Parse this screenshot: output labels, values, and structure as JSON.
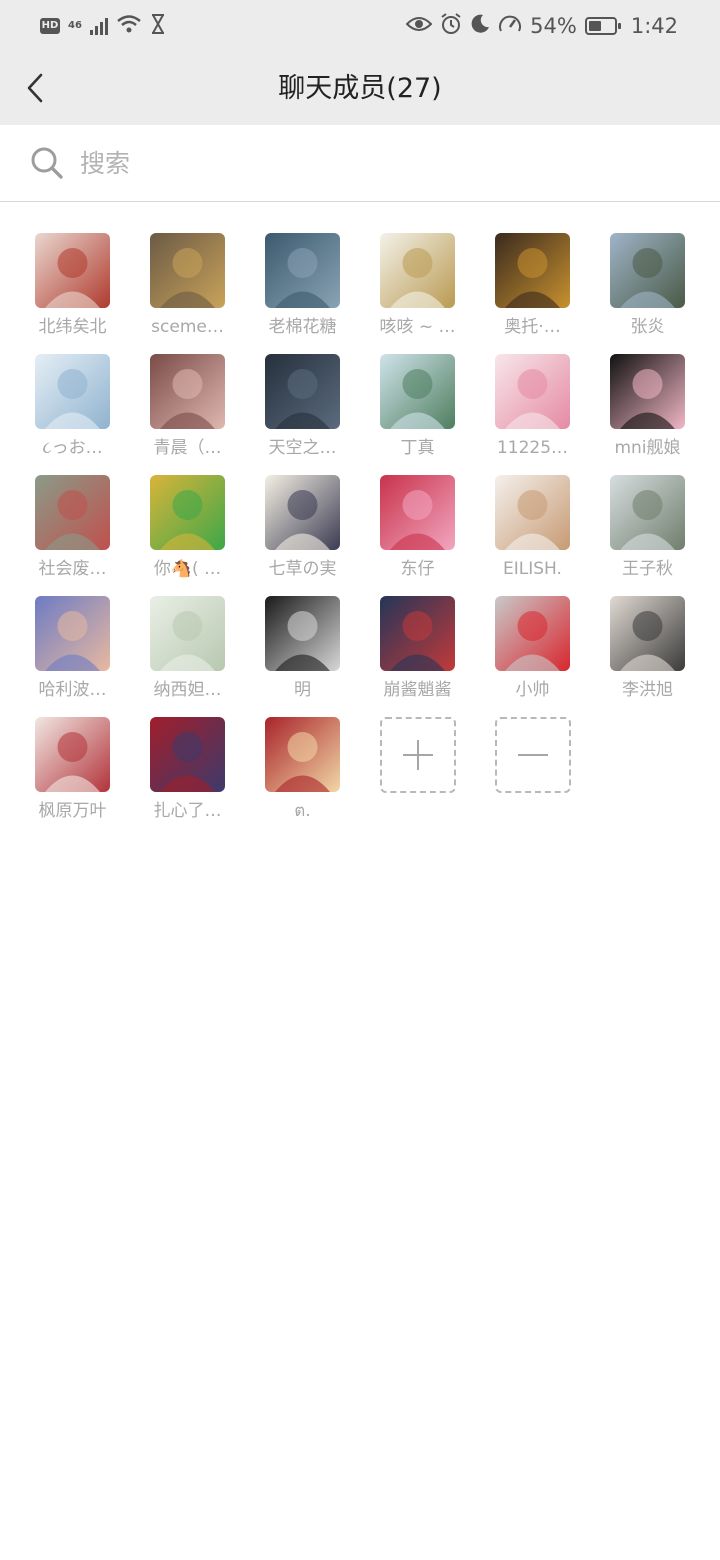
{
  "status_bar": {
    "hd_label": "HD",
    "network_label": "46",
    "battery_text": "54%",
    "battery_level_percent": 54,
    "time": "1:42",
    "icons": [
      "hd-icon",
      "signal-icon",
      "wifi-icon",
      "hourglass-icon",
      "eye-icon",
      "alarm-icon",
      "moon-icon",
      "speedometer-icon",
      "battery-icon"
    ]
  },
  "header": {
    "title": "聊天成员(27)",
    "back_icon": "chevron-left-icon",
    "background": "#ececec"
  },
  "search": {
    "placeholder": "搜索",
    "value": "",
    "icon": "search-icon"
  },
  "members": [
    {
      "name": "北纬矣北",
      "colors": [
        "#e9d7cf",
        "#b03a2e"
      ]
    },
    {
      "name": "sceme…",
      "colors": [
        "#6b5a45",
        "#c9a35a"
      ]
    },
    {
      "name": "老棉花糖",
      "colors": [
        "#3c5a6e",
        "#8aa3b5"
      ]
    },
    {
      "name": "咳咳 ~ …",
      "colors": [
        "#f3f1e8",
        "#b99a52"
      ]
    },
    {
      "name": "奥托·…",
      "colors": [
        "#3a2a1e",
        "#c8912f"
      ]
    },
    {
      "name": "张炎",
      "colors": [
        "#9fb4c8",
        "#4a5a46"
      ]
    },
    {
      "name": "૮っお…",
      "colors": [
        "#e5eef5",
        "#8fb3cf"
      ]
    },
    {
      "name": "青晨（…",
      "colors": [
        "#7a4b48",
        "#e0b8b0"
      ]
    },
    {
      "name": "天空之…",
      "colors": [
        "#26303c",
        "#5b6b7e"
      ]
    },
    {
      "name": "丁真",
      "colors": [
        "#cfe3ea",
        "#4f7e5f"
      ]
    },
    {
      "name": "11225…",
      "colors": [
        "#f7e6ea",
        "#e58aa4"
      ]
    },
    {
      "name": "mni舰娘",
      "colors": [
        "#111111",
        "#f2b7c6"
      ]
    },
    {
      "name": "社会废…",
      "colors": [
        "#8a9b88",
        "#c0504d"
      ]
    },
    {
      "name": "你🐴( …",
      "colors": [
        "#d9b43b",
        "#3da748"
      ]
    },
    {
      "name": "七草の実",
      "colors": [
        "#f4efe3",
        "#3b3b52"
      ]
    },
    {
      "name": "东仔",
      "colors": [
        "#c9324b",
        "#f2a6c0"
      ]
    },
    {
      "name": "EILISH.",
      "colors": [
        "#f4f0ec",
        "#c79a73"
      ]
    },
    {
      "name": "王子秋",
      "colors": [
        "#d7dde0",
        "#6f7e6c"
      ]
    },
    {
      "name": "哈利波…",
      "colors": [
        "#6d7bc4",
        "#e8b9a0"
      ]
    },
    {
      "name": "纳西妲…",
      "colors": [
        "#e9efe6",
        "#b8c8b0"
      ]
    },
    {
      "name": "明",
      "colors": [
        "#1a1a1a",
        "#d8d8d8"
      ]
    },
    {
      "name": "崩酱魈酱",
      "colors": [
        "#243559",
        "#c23a3a"
      ]
    },
    {
      "name": "小帅",
      "colors": [
        "#c9c9c9",
        "#d8262e"
      ]
    },
    {
      "name": "李洪旭",
      "colors": [
        "#e1dad3",
        "#3a3a3a"
      ]
    },
    {
      "name": "枫原万叶",
      "colors": [
        "#f1e7e2",
        "#b2333a"
      ]
    },
    {
      "name": "扎心了…",
      "colors": [
        "#a11e2a",
        "#3d3a6b"
      ]
    },
    {
      "name": "ต.",
      "colors": [
        "#a8232a",
        "#f2d7a6"
      ]
    }
  ],
  "actions": {
    "add_icon": "plus-icon",
    "remove_icon": "minus-icon"
  }
}
